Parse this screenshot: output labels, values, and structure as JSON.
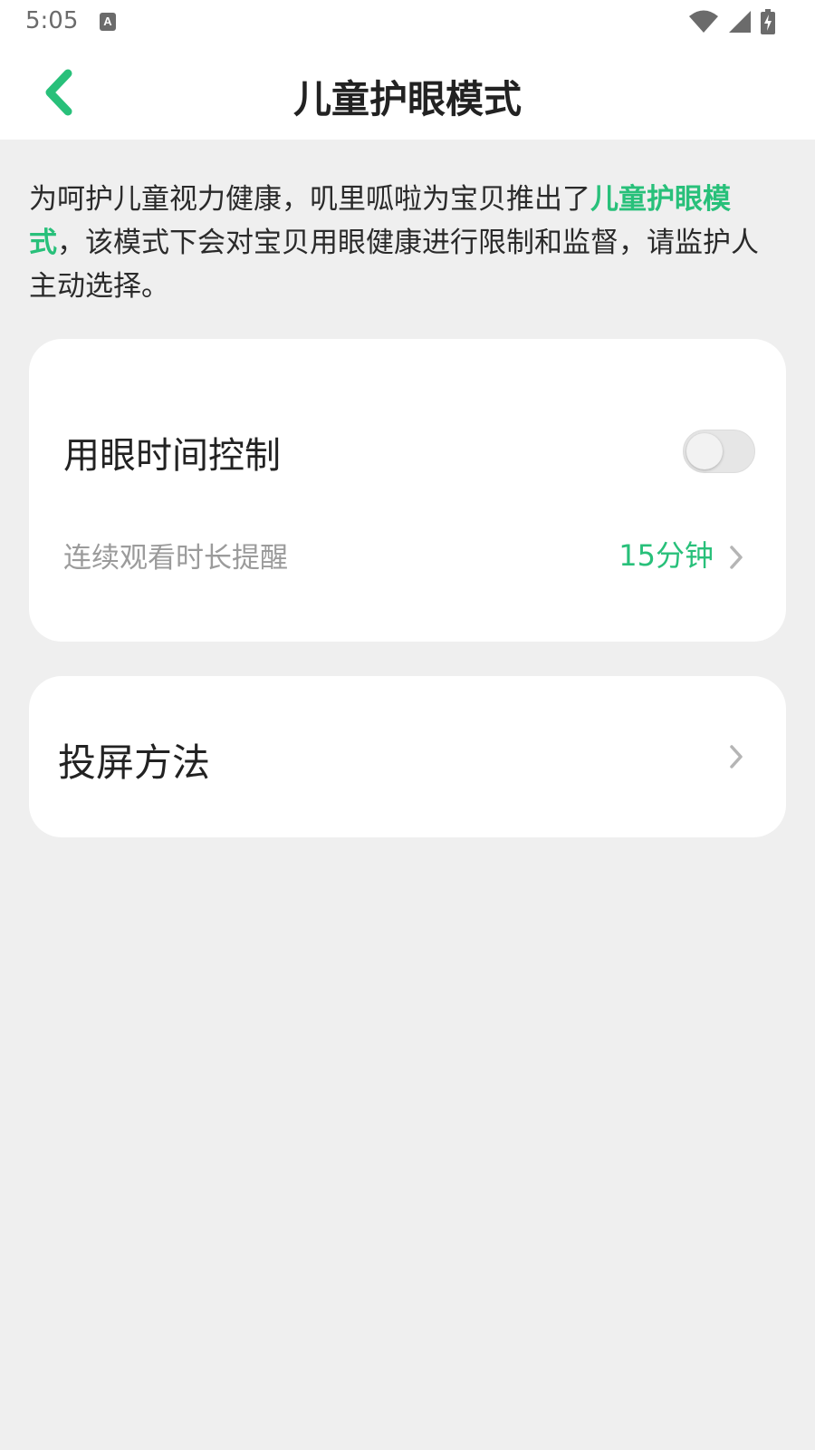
{
  "status_bar": {
    "time": "5:05",
    "icons": [
      "keyboard-a-icon",
      "wifi-icon",
      "signal-icon",
      "battery-charging-icon"
    ]
  },
  "app_bar": {
    "title": "儿童护眼模式",
    "back_icon": "chevron-left-icon",
    "accent_color": "#28c07a"
  },
  "intro": {
    "text_part1": "为呵护儿童视力健康，叽里呱啦为宝贝推出了",
    "highlight": "儿童护眼模式",
    "text_part2": "，该模式下会对宝贝用眼健康进行限制和监督，请监护人主动选择。"
  },
  "eye_time_card": {
    "title": "用眼时间控制",
    "toggle_on": false,
    "reminder_label": "连续观看时长提醒",
    "reminder_value": "15分钟"
  },
  "cast_card": {
    "title": "投屏方法"
  }
}
